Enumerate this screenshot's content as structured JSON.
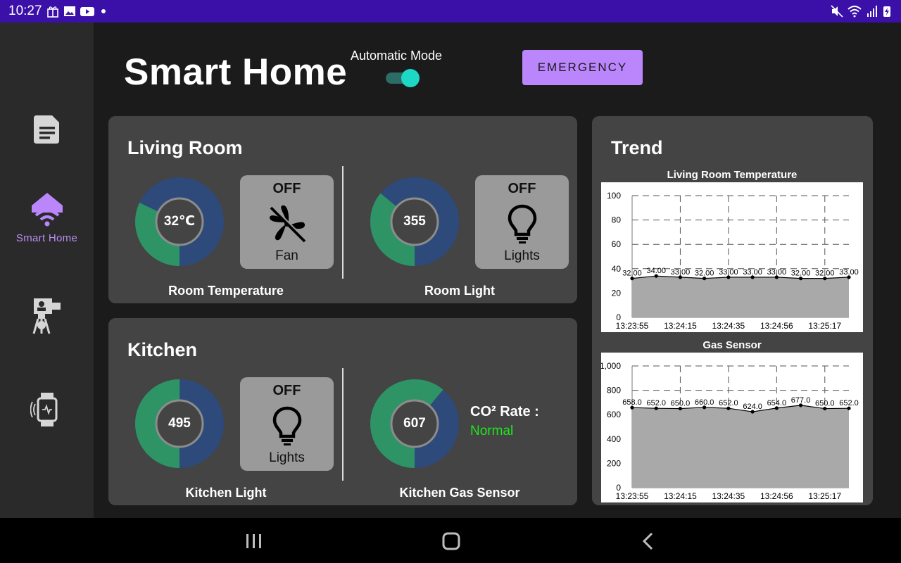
{
  "status_bar": {
    "time": "10:27"
  },
  "sidebar": {
    "items": [
      {
        "icon": "document-icon",
        "label": ""
      },
      {
        "icon": "smart-home-icon",
        "label": "Smart Home",
        "active": true
      },
      {
        "icon": "remote-monitor-icon",
        "label": ""
      },
      {
        "icon": "smartwatch-icon",
        "label": ""
      }
    ]
  },
  "header": {
    "title": "Smart Home",
    "automatic_mode_label": "Automatic Mode",
    "automatic_mode_on": true,
    "emergency_label": "EMERGENCY"
  },
  "colors": {
    "accent": "#bb86fc",
    "gauge_filled": "#2e9465",
    "gauge_rest": "#2d4a7a",
    "toggle": "#1ed8c6",
    "normal_green": "#1ee81e"
  },
  "living_room": {
    "title": "Living Room",
    "temperature": {
      "value": "32℃",
      "fraction": 0.32,
      "caption": "Room Temperature"
    },
    "fan": {
      "state": "OFF",
      "label": "Fan"
    },
    "light_sensor": {
      "value": "355",
      "fraction": 0.36,
      "caption": "Room Light"
    },
    "lights": {
      "state": "OFF",
      "label": "Lights"
    }
  },
  "kitchen": {
    "title": "Kitchen",
    "light_sensor": {
      "value": "495",
      "fraction": 0.5,
      "caption": "Kitchen Light"
    },
    "lights": {
      "state": "OFF",
      "label": "Lights"
    },
    "gas_sensor": {
      "value": "607",
      "fraction": 0.61,
      "caption": "Kitchen Gas Sensor"
    },
    "co2": {
      "label": "CO² Rate :",
      "status": "Normal"
    }
  },
  "trend": {
    "title": "Trend"
  },
  "chart_data": [
    {
      "type": "area",
      "title": "Living Room Temperature",
      "ylim": [
        0,
        100
      ],
      "yticks": [
        "0",
        "20",
        "40",
        "60",
        "80",
        "100"
      ],
      "xticks": [
        "13:23:55",
        "13:24:15",
        "13:24:35",
        "13:24:56",
        "13:25:17"
      ],
      "values": [
        32.0,
        34.0,
        33.0,
        32.0,
        33.0,
        33.0,
        33.0,
        32.0,
        32.0,
        33.0
      ],
      "labels": [
        "32.00",
        "34.00",
        "33.00",
        "32.00",
        "33.00",
        "33.00",
        "33.00",
        "32.00",
        "32.00",
        "33.00"
      ],
      "grid": true
    },
    {
      "type": "area",
      "title": "Gas Sensor",
      "ylim": [
        0,
        1000
      ],
      "yticks": [
        "0",
        "200",
        "400",
        "600",
        "800",
        "1,000"
      ],
      "xticks": [
        "13:23:55",
        "13:24:15",
        "13:24:35",
        "13:24:56",
        "13:25:17"
      ],
      "values": [
        658.0,
        652.0,
        650.0,
        660.0,
        652.0,
        624.0,
        654.0,
        677.0,
        650.0,
        652.0
      ],
      "labels": [
        "658.0",
        "652.0",
        "650.0",
        "660.0",
        "652.0",
        "624.0",
        "654.0",
        "677.0",
        "650.0",
        "652.0"
      ],
      "grid": true
    }
  ]
}
